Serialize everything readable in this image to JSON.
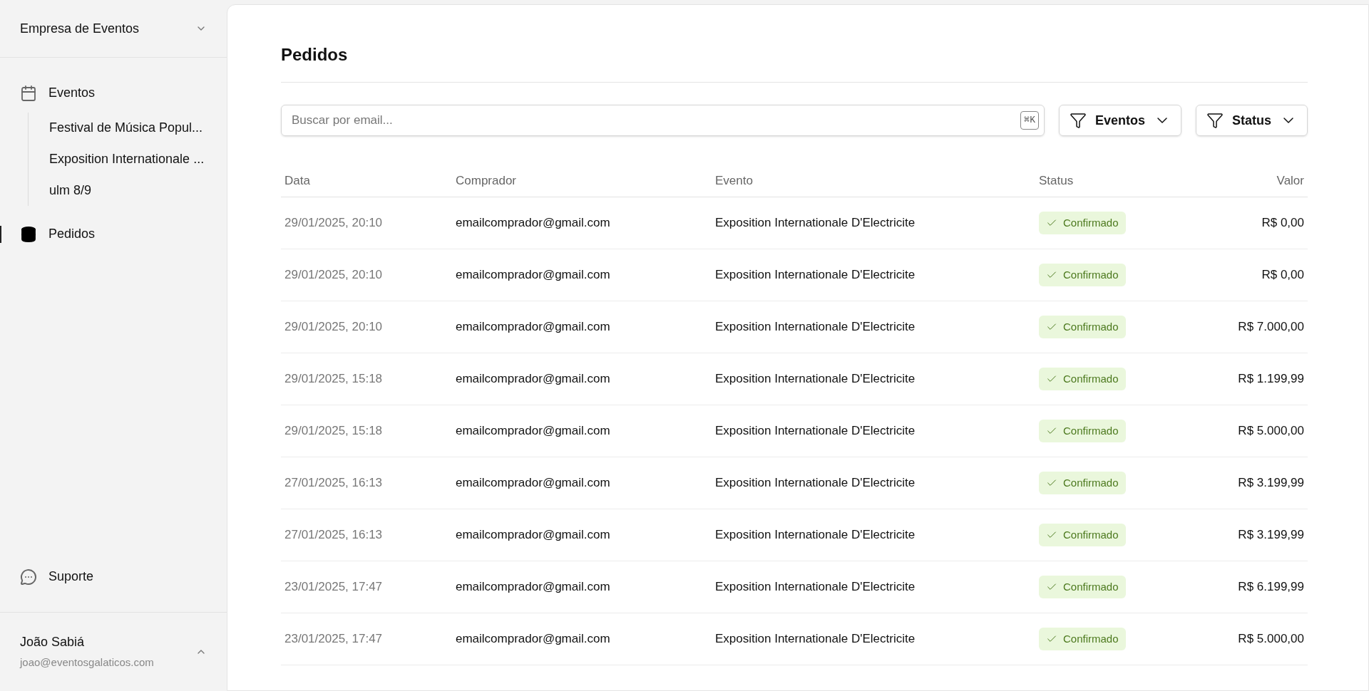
{
  "sidebar": {
    "org": "Empresa de Eventos",
    "nav": [
      {
        "label": "Eventos",
        "kind": "calendar",
        "selected": false,
        "children": [
          {
            "label": "Festival de Música Popul..."
          },
          {
            "label": "Exposition Internationale ..."
          },
          {
            "label": "ulm 8/9"
          }
        ]
      },
      {
        "label": "Pedidos",
        "kind": "database",
        "selected": true
      }
    ],
    "support": {
      "label": "Suporte"
    },
    "user": {
      "name": "João Sabiá",
      "email": "joao@eventosgalaticos.com"
    }
  },
  "page": {
    "title": "Pedidos",
    "search": {
      "placeholder": "Buscar por email...",
      "shortcut": "⌘K"
    },
    "filters": [
      {
        "label": "Eventos"
      },
      {
        "label": "Status"
      }
    ],
    "table": {
      "columns": [
        "Data",
        "Comprador",
        "Evento",
        "Status",
        "Valor"
      ],
      "rows": [
        {
          "date": "29/01/2025, 20:10",
          "buyer": "emailcomprador@gmail.com",
          "event": "Exposition Internationale D'Electricite",
          "status": {
            "label": "Confirmado",
            "kind": "confirmed"
          },
          "value": "R$ 0,00"
        },
        {
          "date": "29/01/2025, 20:10",
          "buyer": "emailcomprador@gmail.com",
          "event": "Exposition Internationale D'Electricite",
          "status": {
            "label": "Confirmado",
            "kind": "confirmed"
          },
          "value": "R$ 0,00"
        },
        {
          "date": "29/01/2025, 20:10",
          "buyer": "emailcomprador@gmail.com",
          "event": "Exposition Internationale D'Electricite",
          "status": {
            "label": "Confirmado",
            "kind": "confirmed"
          },
          "value": "R$ 7.000,00"
        },
        {
          "date": "29/01/2025, 15:18",
          "buyer": "emailcomprador@gmail.com",
          "event": "Exposition Internationale D'Electricite",
          "status": {
            "label": "Confirmado",
            "kind": "confirmed"
          },
          "value": "R$ 1.199,99"
        },
        {
          "date": "29/01/2025, 15:18",
          "buyer": "emailcomprador@gmail.com",
          "event": "Exposition Internationale D'Electricite",
          "status": {
            "label": "Confirmado",
            "kind": "confirmed"
          },
          "value": "R$ 5.000,00"
        },
        {
          "date": "27/01/2025, 16:13",
          "buyer": "emailcomprador@gmail.com",
          "event": "Exposition Internationale D'Electricite",
          "status": {
            "label": "Confirmado",
            "kind": "confirmed"
          },
          "value": "R$ 3.199,99"
        },
        {
          "date": "27/01/2025, 16:13",
          "buyer": "emailcomprador@gmail.com",
          "event": "Exposition Internationale D'Electricite",
          "status": {
            "label": "Confirmado",
            "kind": "confirmed"
          },
          "value": "R$ 3.199,99"
        },
        {
          "date": "23/01/2025, 17:47",
          "buyer": "emailcomprador@gmail.com",
          "event": "Exposition Internationale D'Electricite",
          "status": {
            "label": "Confirmado",
            "kind": "confirmed"
          },
          "value": "R$ 6.199,99"
        },
        {
          "date": "23/01/2025, 17:47",
          "buyer": "emailcomprador@gmail.com",
          "event": "Exposition Internationale D'Electricite",
          "status": {
            "label": "Confirmado",
            "kind": "confirmed"
          },
          "value": "R$ 5.000,00"
        }
      ]
    }
  }
}
